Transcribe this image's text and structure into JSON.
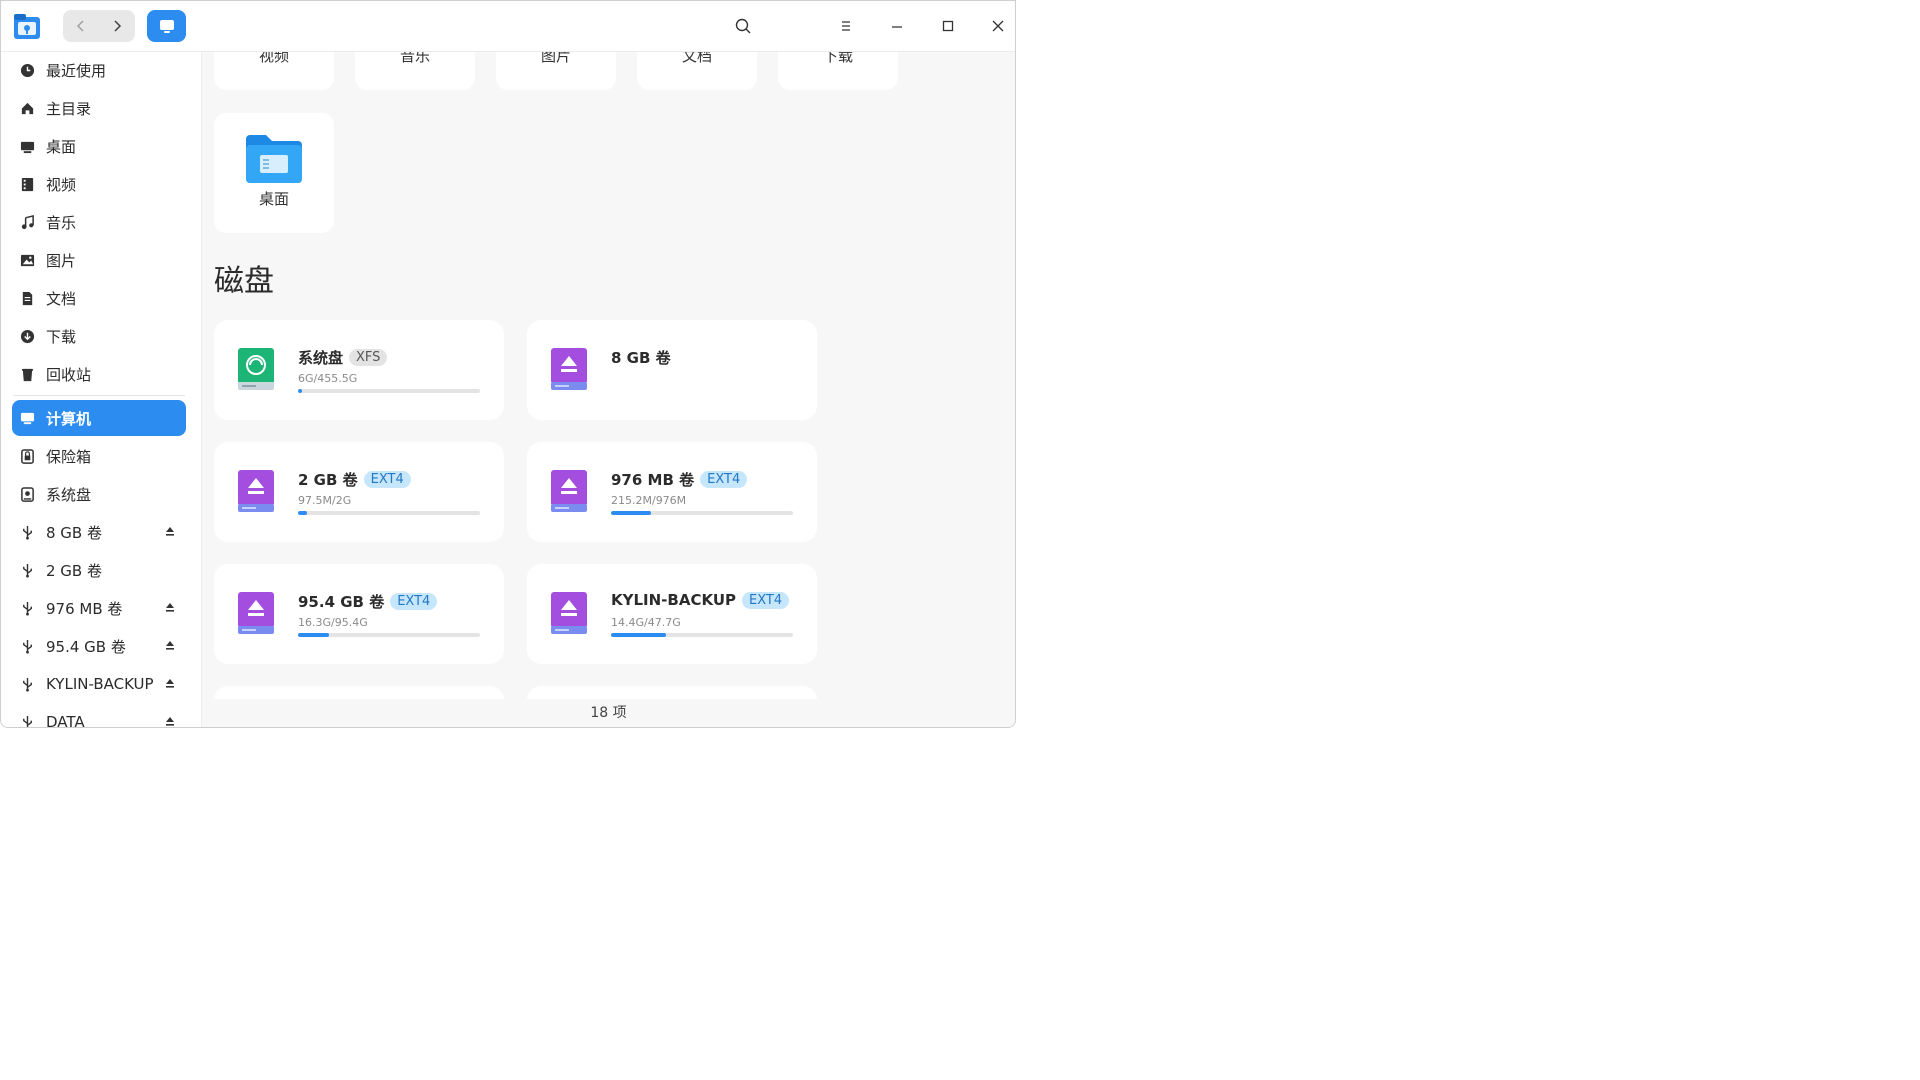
{
  "sidebar": {
    "items": [
      {
        "label": "最近使用",
        "icon": "clock-icon"
      },
      {
        "label": "主目录",
        "icon": "home-icon"
      },
      {
        "label": "桌面",
        "icon": "desktop-icon"
      },
      {
        "label": "视频",
        "icon": "film-icon"
      },
      {
        "label": "音乐",
        "icon": "music-icon"
      },
      {
        "label": "图片",
        "icon": "image-icon"
      },
      {
        "label": "文档",
        "icon": "document-icon"
      },
      {
        "label": "下载",
        "icon": "download-icon"
      },
      {
        "label": "回收站",
        "icon": "trash-icon"
      },
      {
        "label": "计算机",
        "icon": "computer-icon"
      },
      {
        "label": "保险箱",
        "icon": "vault-icon"
      },
      {
        "label": "系统盘",
        "icon": "disk-icon"
      },
      {
        "label": "8 GB 卷",
        "icon": "usb-icon"
      },
      {
        "label": "2 GB 卷",
        "icon": "usb-icon"
      },
      {
        "label": "976 MB 卷",
        "icon": "usb-icon"
      },
      {
        "label": "95.4 GB 卷",
        "icon": "usb-icon"
      },
      {
        "label": "KYLIN-BACKUP",
        "icon": "usb-icon"
      },
      {
        "label": "DATA",
        "icon": "usb-icon"
      }
    ]
  },
  "folders": [
    {
      "label": "视频"
    },
    {
      "label": "音乐"
    },
    {
      "label": "图片"
    },
    {
      "label": "文档"
    },
    {
      "label": "下载"
    },
    {
      "label": "桌面"
    }
  ],
  "section_title": "磁盘",
  "disks": [
    {
      "name": "系统盘",
      "fs": "XFS",
      "usage": "6G/455.5G",
      "used_fraction": 0.013,
      "icon": "system-disk-icon"
    },
    {
      "name": "8 GB 卷",
      "fs": "",
      "usage": "",
      "used_fraction": 0,
      "icon": "removable-disk-icon"
    },
    {
      "name": "2 GB 卷",
      "fs": "EXT4",
      "usage": "97.5M/2G",
      "used_fraction": 0.048,
      "icon": "removable-disk-icon"
    },
    {
      "name": "976 MB 卷",
      "fs": "EXT4",
      "usage": "215.2M/976M",
      "used_fraction": 0.22,
      "icon": "removable-disk-icon"
    },
    {
      "name": "95.4 GB 卷",
      "fs": "EXT4",
      "usage": "16.3G/95.4G",
      "used_fraction": 0.171,
      "icon": "removable-disk-icon"
    },
    {
      "name": "KYLIN-BACKUP",
      "fs": "EXT4",
      "usage": "14.4G/47.7G",
      "used_fraction": 0.302,
      "icon": "removable-disk-icon"
    }
  ],
  "status": "18 项",
  "colors": {
    "accent": "#2d8cf0",
    "folder": "#2196f3",
    "disk_purple": "#a44ee0",
    "disk_green": "#1db576",
    "badge_ext4_bg": "#c6e6fb"
  }
}
